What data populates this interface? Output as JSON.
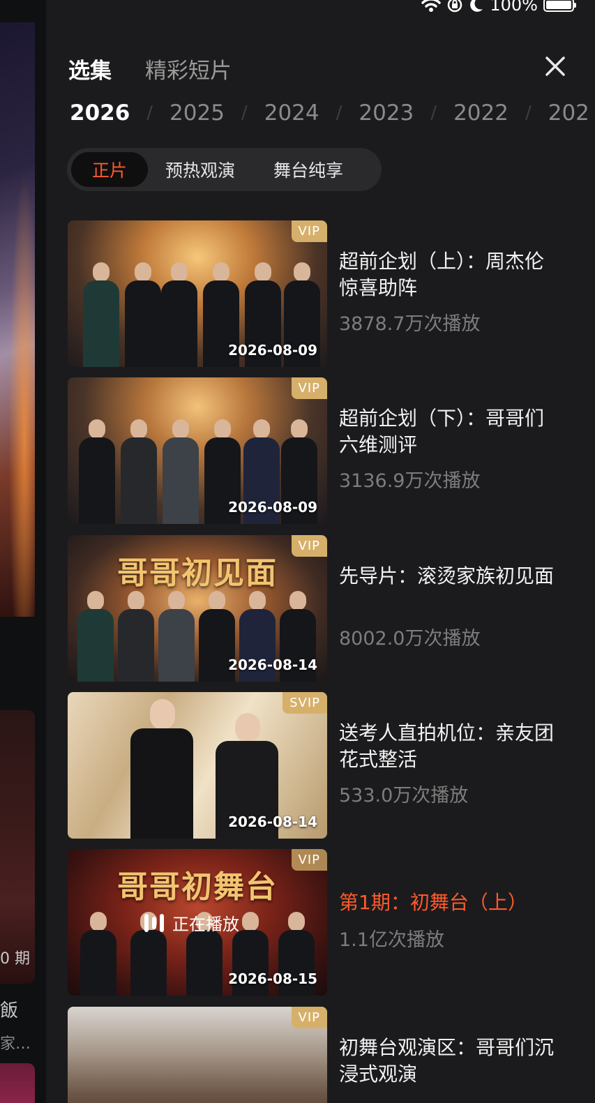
{
  "status_bar": {
    "battery_percent": "100%",
    "icons": [
      "wifi-icon",
      "orientation-lock-icon",
      "moon-icon",
      "battery-icon"
    ]
  },
  "background": {
    "episode_label_fragment": "0 期",
    "title_fragment": "飯",
    "subtitle_fragment": "家…"
  },
  "panel": {
    "tabs": [
      {
        "label": "选集",
        "active": true
      },
      {
        "label": "精彩短片",
        "active": false
      }
    ],
    "close_icon": "close-icon",
    "years": [
      "2026",
      "2025",
      "2024",
      "2023",
      "2022",
      "202"
    ],
    "selected_year": "2026",
    "year_separator": "/",
    "segments": [
      {
        "label": "正片",
        "active": true
      },
      {
        "label": "预热观演",
        "active": false
      },
      {
        "label": "舞台纯享",
        "active": false
      }
    ],
    "accent_color": "#ff5a2b",
    "badge_color": "#d6b06b"
  },
  "episodes": [
    {
      "title": "超前企划（上）：周杰伦惊喜助阵",
      "views": "3878.7万次播放",
      "badge": "VIP",
      "date": "2026-08-09",
      "playing": false
    },
    {
      "title": "超前企划（下）：哥哥们六维测评",
      "views": "3136.9万次播放",
      "badge": "VIP",
      "date": "2026-08-09",
      "playing": false
    },
    {
      "title": "先导片：滚烫家族初见面",
      "views": "8002.0万次播放",
      "badge": "VIP",
      "date": "2026-08-14",
      "thumb_title": "哥哥初见面",
      "playing": false
    },
    {
      "title": "送考人直拍机位：亲友团花式整活",
      "views": "533.0万次播放",
      "badge": "SVIP",
      "date": "2026-08-14",
      "playing": false
    },
    {
      "title": "第1期：初舞台（上）",
      "views": "1.1亿次播放",
      "badge": "VIP",
      "date": "2026-08-15",
      "thumb_title": "哥哥初舞台",
      "playing": true,
      "playing_label": "正在播放"
    },
    {
      "title": "初舞台观演区：哥哥们沉浸式观演",
      "views": "",
      "badge": "VIP",
      "date": "",
      "playing": false
    }
  ]
}
